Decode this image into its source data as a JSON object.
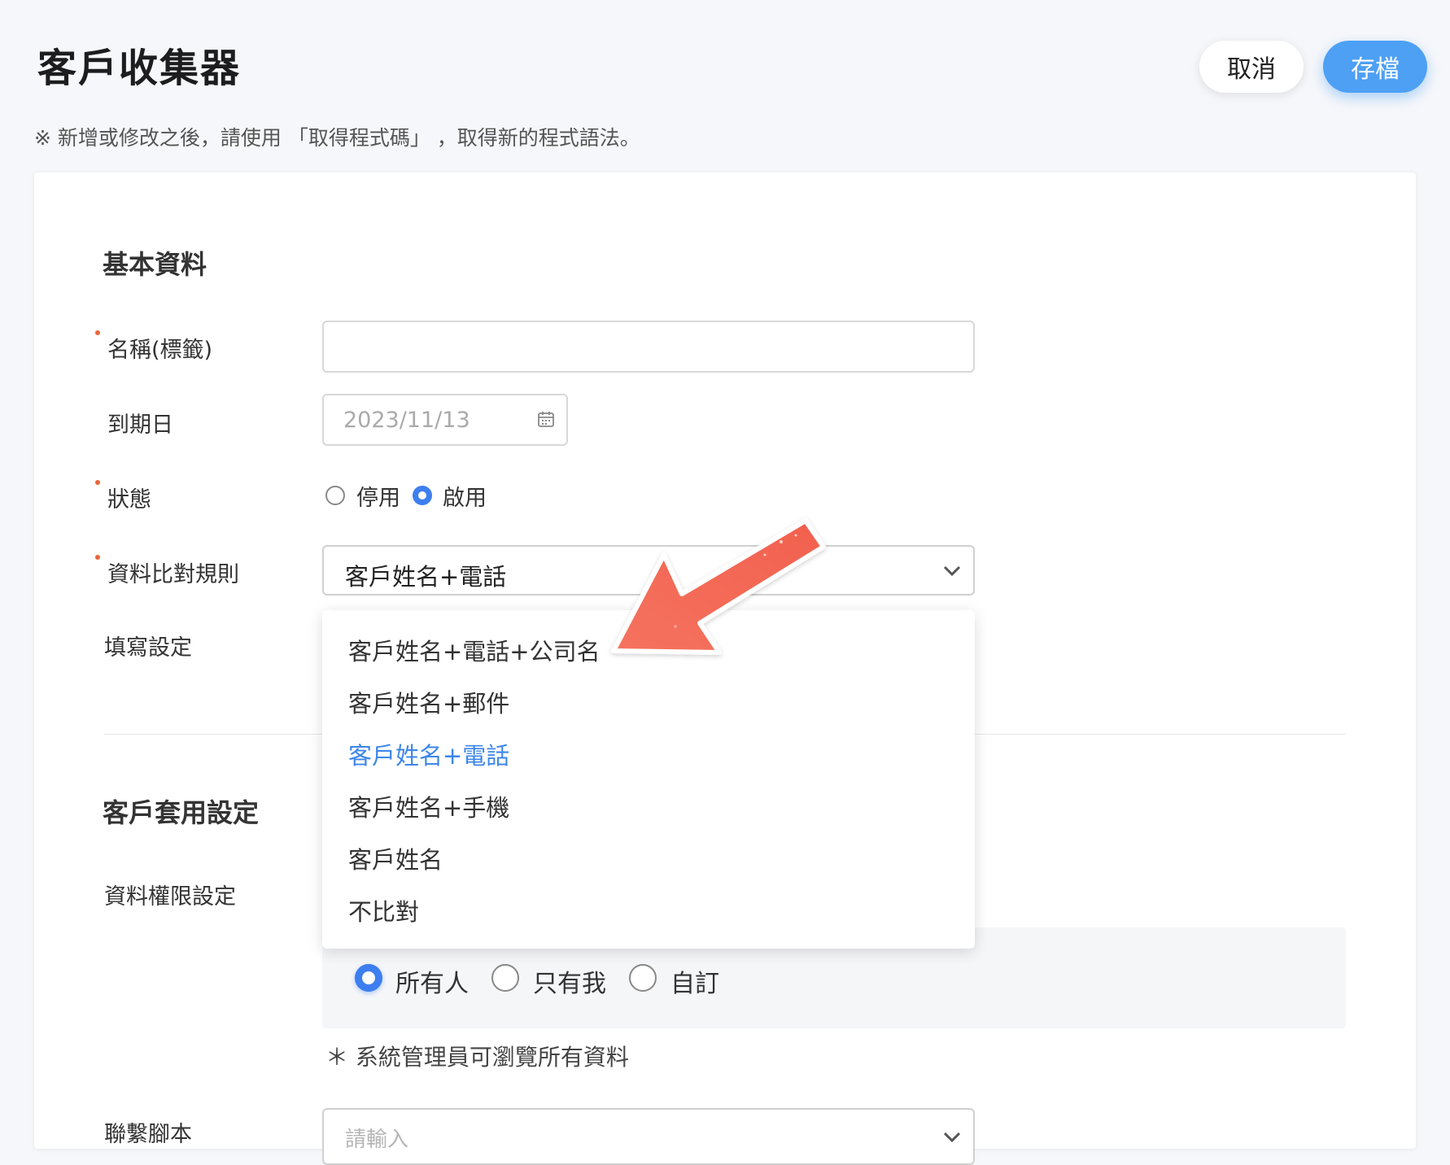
{
  "header": {
    "title": "客戶收集器",
    "cancel_label": "取消",
    "save_label": "存檔",
    "notice": "※ 新增或修改之後，請使用 「取得程式碼」 ，取得新的程式語法。"
  },
  "basic": {
    "section_title": "基本資料",
    "name_label": "名稱(標籤)",
    "name_value": "",
    "expiry_label": "到期日",
    "expiry_value": "2023/11/13",
    "status_label": "狀態",
    "status_options": [
      "停用",
      "啟用"
    ],
    "status_selected": "啟用",
    "match_label": "資料比對規則",
    "match_value": "客戶姓名+電話",
    "fill_label": "填寫設定"
  },
  "match_dropdown": {
    "options": [
      "客戶姓名+電話+公司名",
      "客戶姓名+郵件",
      "客戶姓名+電話",
      "客戶姓名+手機",
      "客戶姓名",
      "不比對"
    ],
    "selected": "客戶姓名+電話"
  },
  "customer": {
    "section_title": "客戶套用設定",
    "perm_label": "資料權限設定",
    "perm_options": [
      "所有人",
      "只有我",
      "自訂"
    ],
    "perm_selected": "所有人",
    "perm_note": "＊ 系統管理員可瀏覽所有資料",
    "script_label": "聯繫腳本",
    "script_placeholder": "請輸入"
  },
  "colors": {
    "accent": "#3d7ef0",
    "save_button": "#4da0f4",
    "required_dot": "#e8663a",
    "selected_option": "#3d86ea",
    "annotation_arrow": "#f46b57"
  },
  "icons": [
    "calendar-icon",
    "chevron-down-icon",
    "annotation-arrow-icon"
  ]
}
